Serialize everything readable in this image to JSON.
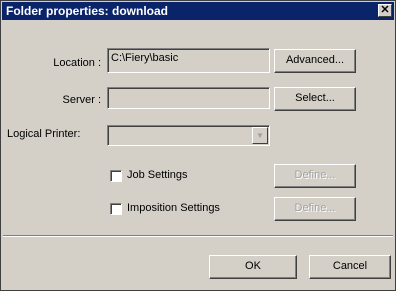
{
  "window": {
    "title": "Folder properties: download",
    "close_glyph": "✕"
  },
  "location": {
    "label": "Location :",
    "value": "C:\\Fiery\\basic",
    "button": "Advanced..."
  },
  "server": {
    "label": "Server :",
    "value": "",
    "button": "Select..."
  },
  "logical_printer": {
    "label": "Logical Printer:",
    "value": "",
    "arrow_icon": "dropdown-arrow"
  },
  "job_settings": {
    "label": "Job Settings",
    "checked": false,
    "button": "Define..."
  },
  "imposition_settings": {
    "label": "Imposition Settings",
    "checked": false,
    "button": "Define..."
  },
  "footer": {
    "ok": "OK",
    "cancel": "Cancel"
  },
  "colors": {
    "titlebar": "#0a246a",
    "dialog": "#d4d0c8"
  }
}
